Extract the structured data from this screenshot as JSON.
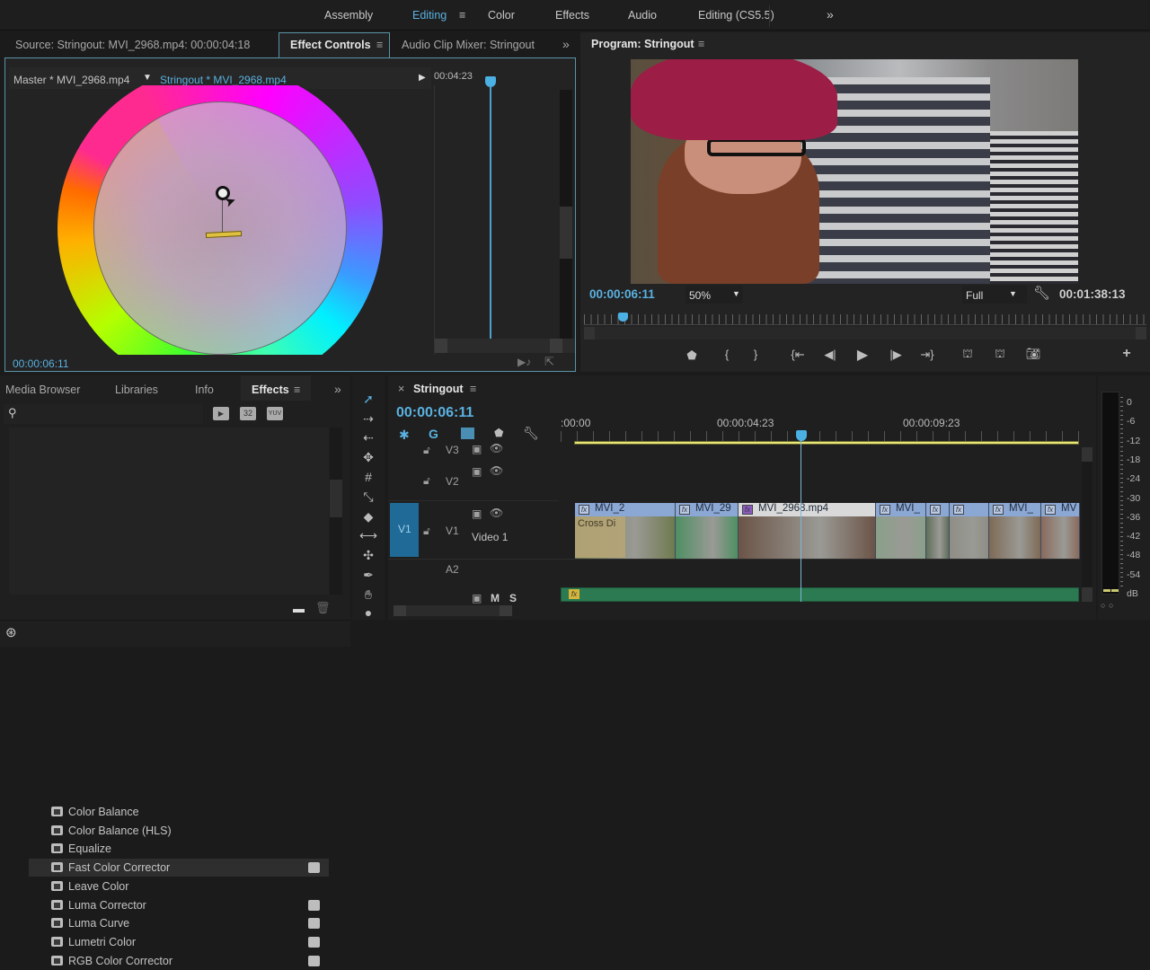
{
  "workspaces": {
    "items": [
      "Assembly",
      "Editing",
      "Color",
      "Effects",
      "Audio",
      "Editing (CS5.5)"
    ],
    "active": "Editing",
    "overflow": "»"
  },
  "source_panel": {
    "tabs": [
      "Source: Stringout: MVI_2968.mp4: 00:00:04:18",
      "Effect Controls",
      "Audio Clip Mixer: Stringout"
    ],
    "active_tab": "Effect Controls",
    "overflow": "»",
    "master_clip": "Master * MVI_2968.mp4",
    "sequence_clip": "Stringout * MVI_2968.mp4",
    "ruler_time": "00:04:23",
    "timecode": "00:00:06:11",
    "color_wheel": {
      "label": "Hue balance color wheel",
      "accent": "#e0c040"
    }
  },
  "program_monitor": {
    "title": "Program: Stringout",
    "timecode": "00:00:06:11",
    "zoom": "50%",
    "resolution": "Full",
    "duration": "00:01:38:13",
    "playhead_fraction": 0.06,
    "controls": [
      "add-marker",
      "mark-in",
      "mark-out",
      "go-to-in",
      "step-back",
      "play",
      "step-forward",
      "go-to-out",
      "lift",
      "extract",
      "export-frame"
    ],
    "add_button": "+"
  },
  "effects_panel": {
    "tabs": [
      "Media Browser",
      "Libraries",
      "Info",
      "Effects"
    ],
    "active_tab": "Effects",
    "overflow": "»",
    "search_placeholder": "",
    "filter_badges": [
      "accelerated",
      "32",
      "YUV"
    ],
    "items": [
      {
        "label": "Color Balance",
        "accelerated": false
      },
      {
        "label": "Color Balance (HLS)",
        "accelerated": false
      },
      {
        "label": "Equalize",
        "accelerated": false
      },
      {
        "label": "Fast Color Corrector",
        "accelerated": true,
        "selected": true
      },
      {
        "label": "Leave Color",
        "accelerated": false
      },
      {
        "label": "Luma Corrector",
        "accelerated": true
      },
      {
        "label": "Luma Curve",
        "accelerated": true
      },
      {
        "label": "Lumetri Color",
        "accelerated": true
      },
      {
        "label": "RGB Color Corrector",
        "accelerated": true
      }
    ]
  },
  "timeline": {
    "tab": "Stringout",
    "timecode": "00:00:06:11",
    "ruler": [
      ":00:00",
      "00:00:04:23",
      "00:00:09:23"
    ],
    "tracks": {
      "v3": "V3",
      "v2": "V2",
      "v1": "V1",
      "v1_source": "V1",
      "v1_name": "Video 1",
      "a2": "A2",
      "mute": "M",
      "solo": "S"
    },
    "clips": [
      {
        "label": "MVI_2",
        "transition": "Cross Di"
      },
      {
        "label": "MVI_29"
      },
      {
        "label": "MVI_2968.mp4",
        "selected": true
      },
      {
        "label": "MVI_"
      },
      {
        "label": ""
      },
      {
        "label": ""
      },
      {
        "label": "MVI_"
      },
      {
        "label": "MV"
      }
    ]
  },
  "audio_meter": {
    "scale": [
      "0",
      "-6",
      "-12",
      "-18",
      "-24",
      "-30",
      "-36",
      "-42",
      "-48",
      "-54",
      "dB"
    ],
    "solo_buttons": [
      "S",
      "S"
    ]
  },
  "colors": {
    "accent": "#5ab1e0",
    "panel": "#232323",
    "clip_video": "#8ba7d3",
    "clip_audio": "#2b7a52",
    "work_area": "#e7e77a"
  }
}
